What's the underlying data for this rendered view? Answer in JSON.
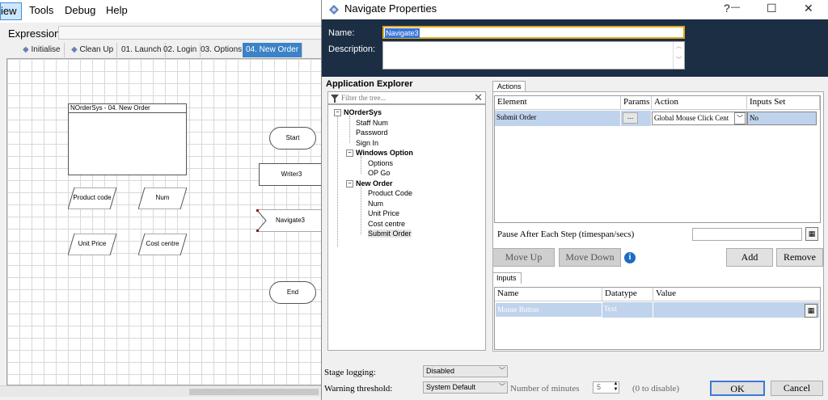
{
  "app": {
    "menu": [
      "View",
      "Tools",
      "Debug",
      "Help"
    ],
    "menu_view_visible": "iew",
    "expression_label": "Expression:",
    "page_tabs": [
      "Initialise",
      "Clean Up",
      "01. Launch",
      "02. Login",
      "03. Options",
      "04. New Order"
    ],
    "active_tab": "04. New Order",
    "flowchart": {
      "block_title": "NOrderSys - 04. New Order",
      "data_items": [
        "Product code",
        "Num",
        "Unit Price",
        "Cost centre"
      ],
      "start": "Start",
      "writer": "Writer3",
      "navigate": "Navigate3",
      "end": "End"
    }
  },
  "dialog": {
    "title": "Navigate Properties",
    "help": "?",
    "minimize": "—",
    "maximize": "☐",
    "close": "✕",
    "name_label": "Name:",
    "name_value": "Navigate3",
    "description_label": "Description:",
    "app_explorer": {
      "title": "Application Explorer",
      "filter_placeholder": "Filter the tree...",
      "clear_icon": "✕",
      "tree": {
        "root": "NOrderSys",
        "root_items": [
          "Staff Num",
          "Password",
          "Sign In"
        ],
        "windows_option": "Windows Option",
        "windows_option_items": [
          "Options",
          "OP Go"
        ],
        "new_order": "New Order",
        "new_order_items": [
          "Product Code",
          "Num",
          "Unit Price",
          "Cost centre",
          "Submit Order"
        ]
      }
    },
    "actions": {
      "tab": "Actions",
      "columns": [
        "Element",
        "Params",
        "Action",
        "Inputs Set"
      ],
      "row": {
        "element": "Submit Order",
        "params": "...",
        "action": "Global Mouse Click Cent",
        "inputs_set": "No"
      },
      "pause_label": "Pause After Each Step (timespan/secs)",
      "move_up": "Move Up",
      "move_down": "Move Down",
      "info": "i",
      "add": "Add",
      "remove": "Remove"
    },
    "inputs": {
      "tab": "Inputs",
      "columns": [
        "Name",
        "Datatype",
        "Value"
      ],
      "row": {
        "name": "Mouse Button",
        "datatype": "Text",
        "value": ""
      }
    },
    "stage_logging_label": "Stage logging:",
    "stage_logging_value": "Disabled",
    "warning_threshold_label": "Warning threshold:",
    "warning_threshold_value": "System Default",
    "number_of_minutes_label": "Number of minutes",
    "minutes_value": "5",
    "zero_to_disable": "(0 to disable)",
    "ok": "OK",
    "cancel": "Cancel"
  },
  "colors": {
    "header_bg": "#1b2e44",
    "active_tab": "#3c82c8",
    "grid_selection": "#c0d3ec",
    "focus_border": "#e0a81c"
  }
}
